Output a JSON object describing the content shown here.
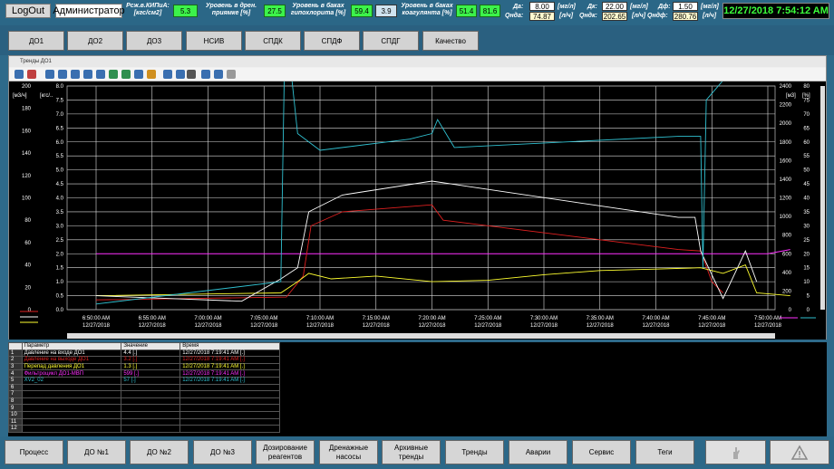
{
  "header": {
    "logout_label": "LogOut",
    "user_label": "Администратор",
    "kipia_label": "Рсж.в.КИПиА: [кгс/см2]",
    "kipia_value": "5.3",
    "drain_label": "Уровень в дрен. приямке [%]",
    "drain_value": "27.5",
    "hypo_label": "Уровень в баках гипохлорита [%]",
    "hypo_value1": "59.4",
    "hypo_value2": "3.9",
    "coag_label": "Уровень в баках коагулянта [%]",
    "coag_value1": "51.4",
    "coag_value2": "81.6",
    "da_label": "Да:",
    "da_value": "8.00",
    "da_unit": "[мг/л]",
    "qnda_label": "Qнда:",
    "qnda_value": "74.87",
    "qnda_unit": "[л/ч]",
    "dk_label": "Дк:",
    "dk_value": "22.00",
    "dk_unit": "[мг/л]",
    "qndk_label": "Qндк:",
    "qndk_value": "202.65",
    "qndk_unit": "[л/ч]",
    "df_label": "Дф:",
    "df_value": "1.50",
    "df_unit": "[мг/л]",
    "qndf_label": "Qндф:",
    "qndf_value": "280.76",
    "qndf_unit": "[л/ч]",
    "clock": "12/27/2018 7:54:12 AM"
  },
  "tabs": [
    "ДО1",
    "ДО2",
    "ДО3",
    "НСИВ",
    "СПДК",
    "СПДФ",
    "СПДГ",
    "Качество"
  ],
  "window_title": "Тренды ДО1",
  "toolbar_icon_names": [
    "help-icon",
    "config-icon",
    "first-icon",
    "prev-icon",
    "back-icon",
    "forward-icon",
    "last-icon",
    "zoom-icon",
    "zoom-in-icon",
    "pan-icon",
    "cursor-icon",
    "legend-icon",
    "grid-icon",
    "print-icon",
    "copy-icon",
    "sync-icon",
    "fx-icon"
  ],
  "chart_data": {
    "type": "line",
    "x": [
      "6:50:00 AM",
      "6:55:00 AM",
      "7:00:00 AM",
      "7:05:00 AM",
      "7:10:00 AM",
      "7:15:00 AM",
      "7:20:00 AM",
      "7:25:00 AM",
      "7:30:00 AM",
      "7:35:00 AM",
      "7:40:00 AM",
      "7:45:00 AM",
      "7:50:00 AM"
    ],
    "x_date": "12/27/2018",
    "axes": {
      "left1": {
        "unit": "[м3/ч]",
        "ticks": [
          "200",
          "180",
          "160",
          "140",
          "120",
          "100",
          "80",
          "60",
          "40",
          "20",
          "0"
        ]
      },
      "left2": {
        "unit": "[кгс/..",
        "ticks": [
          "8.0",
          "7.5",
          "7.0",
          "6.5",
          "6.0",
          "5.5",
          "5.0",
          "4.5",
          "4.0",
          "3.5",
          "3.0",
          "2.5",
          "2.0",
          "1.5",
          "1.0",
          "0.5",
          "0.0"
        ]
      },
      "right1": {
        "unit": "[м3]",
        "ticks": [
          "2400",
          "2200",
          "2000",
          "1800",
          "1600",
          "1400",
          "1200",
          "1000",
          "800",
          "600",
          "400",
          "200",
          "0"
        ]
      },
      "right2": {
        "unit": "[%]",
        "ticks": [
          "80",
          "75",
          "70",
          "65",
          "60",
          "55",
          "50",
          "45",
          "40",
          "35",
          "30",
          "25",
          "20",
          "15",
          "10",
          "5",
          "0"
        ]
      }
    },
    "series": [
      {
        "name": "Давление на входе ДО1",
        "color": "#ffffff",
        "unit": "кгс/см2",
        "points": [
          [
            0,
            0.5
          ],
          [
            0,
            1.5
          ],
          [
            0,
            0.1
          ]
        ]
      },
      {
        "name": "Давление на выходе ДО1",
        "color": "#e02020",
        "unit": "кгс/см2"
      },
      {
        "name": "Перепад давления ДО1",
        "color": "#ffff30",
        "unit": "кгс/см2"
      },
      {
        "name": "Фильтроцикл ДО1-МВП",
        "color": "#ff30ff",
        "unit": "м3"
      },
      {
        "name": "XV2_02",
        "color": "#30c0d0",
        "unit": "%"
      }
    ],
    "grid": true
  },
  "table": {
    "headers": [
      "Параметр",
      "Значение",
      "Время"
    ],
    "rows": [
      {
        "n": "1",
        "param": "Давление на входе ДО1",
        "value": "4.4 [.]",
        "time": "12/27/2018 7:19:41 AM [.]",
        "color": "#ffffff"
      },
      {
        "n": "2",
        "param": "Давление на выходе ДО1",
        "value": "3.2 [.]",
        "time": "12/27/2018 7:19:41 AM [.]",
        "color": "#e02020"
      },
      {
        "n": "3",
        "param": "Перепад давления ДО1",
        "value": "1.3 [.]",
        "time": "12/27/2018 7:19:41 AM [.]",
        "color": "#ffff30"
      },
      {
        "n": "4",
        "param": "Фильтроцикл ДО1-МВП",
        "value": "599 [.]",
        "time": "12/27/2018 7:19:41 AM [.]",
        "color": "#ff30ff"
      },
      {
        "n": "5",
        "param": "XV2_02",
        "value": "57 [.]",
        "time": "12/27/2018 7:19:41 AM [.]",
        "color": "#30c0d0"
      },
      {
        "n": "6",
        "param": "",
        "value": "",
        "time": "",
        "color": "#fff"
      },
      {
        "n": "7",
        "param": "",
        "value": "",
        "time": "",
        "color": "#fff"
      },
      {
        "n": "8",
        "param": "",
        "value": "",
        "time": "",
        "color": "#fff"
      },
      {
        "n": "9",
        "param": "",
        "value": "",
        "time": "",
        "color": "#fff"
      },
      {
        "n": "10",
        "param": "",
        "value": "",
        "time": "",
        "color": "#fff"
      },
      {
        "n": "11",
        "param": "",
        "value": "",
        "time": "",
        "color": "#fff"
      },
      {
        "n": "12",
        "param": "",
        "value": "",
        "time": "",
        "color": "#fff"
      }
    ]
  },
  "bottom_nav": [
    "Процесс",
    "ДО №1",
    "ДО №2",
    "ДО №3",
    "Дозирование реагентов",
    "Дренажные насосы",
    "Архивные тренды",
    "Тренды",
    "Аварии",
    "Сервис",
    "Теги"
  ]
}
